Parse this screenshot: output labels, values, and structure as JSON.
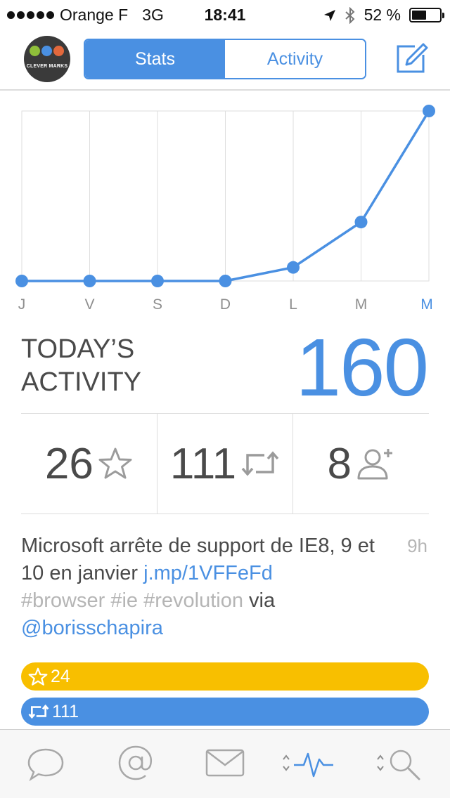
{
  "status_bar": {
    "carrier": "Orange F",
    "network": "3G",
    "time": "18:41",
    "battery_percent": "52 %",
    "battery_level": 0.52
  },
  "header": {
    "logo_text": "CLEVER MARKS",
    "tabs": [
      {
        "label": "Stats",
        "active": true
      },
      {
        "label": "Activity",
        "active": false
      }
    ],
    "compose_icon": "compose-icon"
  },
  "chart_data": {
    "type": "line",
    "categories": [
      "J",
      "V",
      "S",
      "D",
      "L",
      "M",
      "M"
    ],
    "highlighted_category_index": 6,
    "values": [
      0,
      0,
      0,
      0,
      12,
      52,
      150
    ],
    "ylim": [
      0,
      150
    ],
    "grid": true,
    "color": "#4a90e2"
  },
  "today": {
    "label_line1": "TODAY’S",
    "label_line2": "ACTIVITY",
    "value": "160"
  },
  "stats": [
    {
      "value": "26",
      "icon": "star-icon"
    },
    {
      "value": "111",
      "icon": "retweet-icon"
    },
    {
      "value": "8",
      "icon": "add-follower-icon"
    }
  ],
  "tweet": {
    "text_before_link": "Microsoft arrête de support de IE8, 9 et 10 en janvier ",
    "link": "j.mp/1VFFeFd",
    "hashtags": "#browser #ie #revolution",
    "via_text": " via ",
    "mention": "@borisschapira",
    "time": "9h"
  },
  "bars": {
    "favorites": "24",
    "retweets": "111"
  },
  "tabbar": [
    {
      "icon": "chat-bubble-icon",
      "active": false
    },
    {
      "icon": "mention-icon",
      "active": false
    },
    {
      "icon": "mail-icon",
      "active": false
    },
    {
      "icon": "activity-pulse-icon",
      "active": true
    },
    {
      "icon": "search-icon",
      "active": false
    }
  ],
  "colors": {
    "accent": "#4a90e2",
    "favorite": "#f8bf00",
    "text": "#4a4a4a",
    "muted": "#b5b5b5"
  }
}
